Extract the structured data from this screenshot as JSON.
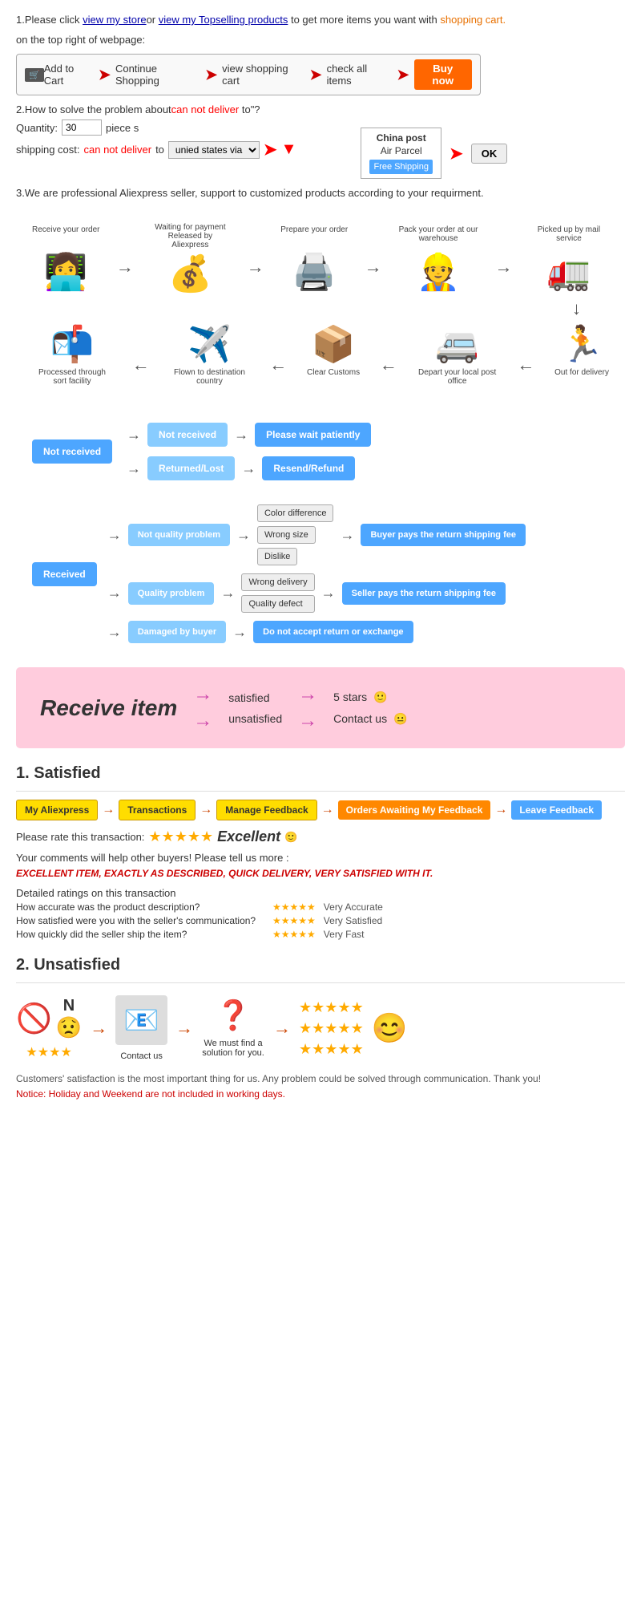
{
  "page": {
    "section1": {
      "text1": "1.Please click ",
      "link1": "view my store",
      "text2": "or ",
      "link2": "view my Topselling products",
      "text3": " to get more items you want with",
      "text4": "shopping cart.",
      "text5": "on the top right of webpage:",
      "flow": {
        "step1": "Add to Cart",
        "step2": "Continue Shopping",
        "step3": "view shopping cart",
        "step4": "check all items",
        "step5": "Buy now"
      }
    },
    "section2": {
      "title": "2.How to solve the problem about",
      "can_not_deliver": "can not deliver",
      "title2": " to\"?",
      "qty_label": "Quantity:",
      "qty_value": "30",
      "qty_unit": "piece s",
      "shipping_label": "shipping cost:",
      "can_not": "can not deliver",
      "to_text": " to ",
      "via_text": "unied states via",
      "china_post_title": "China post",
      "air_parcel": "Air Parcel",
      "free_shipping": "Free Shipping",
      "ok": "OK"
    },
    "section3": {
      "text": "3.We are professional Aliexpress seller, support to customized products according to your requirment."
    },
    "process": {
      "row1": [
        {
          "label_top": "Receive your order",
          "icon": "👩‍💻",
          "label_bot": ""
        },
        {
          "label_top": "Waiting for payment Released by Aliexpress",
          "icon": "💰",
          "label_bot": ""
        },
        {
          "label_top": "Prepare your order",
          "icon": "🖨️",
          "label_bot": ""
        },
        {
          "label_top": "Pack your order at our warehouse",
          "icon": "👷",
          "label_bot": ""
        },
        {
          "label_top": "Picked up by mail service",
          "icon": "🚛",
          "label_bot": ""
        }
      ],
      "row2": [
        {
          "label_top": "",
          "icon": "🏃",
          "label_bot": "Out for delivery"
        },
        {
          "label_top": "",
          "icon": "🚐",
          "label_bot": "Depart your local post office"
        },
        {
          "label_top": "",
          "icon": "📦",
          "label_bot": "Clear Customs"
        },
        {
          "label_top": "",
          "icon": "✈️",
          "label_bot": "Flown to destination country"
        },
        {
          "label_top": "",
          "icon": "📬",
          "label_bot": "Processed through sort facility"
        }
      ]
    },
    "flowchart": {
      "not_received": "Not received",
      "not_received_sub1": "Not received",
      "not_received_sub1_result": "Please wait patiently",
      "not_received_sub2": "Returned/Lost",
      "not_received_sub2_result": "Resend/Refund",
      "received": "Received",
      "not_quality": "Not quality problem",
      "quality": "Quality problem",
      "damaged": "Damaged by buyer",
      "color_diff": "Color difference",
      "wrong_size": "Wrong size",
      "dislike": "Dislike",
      "wrong_delivery": "Wrong delivery",
      "quality_defect": "Quality defect",
      "damaged_result": "Do not accept return or exchange",
      "buyer_pays": "Buyer pays the return shipping fee",
      "seller_pays": "Seller pays the return shipping fee"
    },
    "pink_section": {
      "title": "Receive item",
      "option1": "satisfied",
      "option2": "unsatisfied",
      "result1": "5 stars",
      "result2": "Contact us",
      "emoji1": "🙂",
      "emoji2": "😐"
    },
    "satisfied": {
      "title": "1. Satisfied",
      "flow": [
        "My Aliexpress",
        "Transactions",
        "Manage Feedback",
        "Orders Awaiting My Feedback",
        "Leave Feedback"
      ],
      "rate_text": "Please rate this transaction:",
      "excellent": "Excellent",
      "emoji": "🙂",
      "comment_prompt": "Your comments will help other buyers! Please tell us more :",
      "example": "EXCELLENT ITEM, EXACTLY AS DESCRIBED, QUICK DELIVERY, VERY SATISFIED WITH IT.",
      "ratings_title": "Detailed ratings on this transaction",
      "rating1_label": "How accurate was the product description?",
      "rating1_result": "Very Accurate",
      "rating2_label": "How satisfied were you with the seller's communication?",
      "rating2_result": "Very Satisfied",
      "rating3_label": "How quickly did the seller ship the item?",
      "rating3_result": "Very Fast"
    },
    "unsatisfied": {
      "title": "2. Unsatisfied",
      "steps": [
        "🚫",
        "EMAIL",
        "❓",
        "⭐"
      ],
      "contact_us": "Contact us",
      "find_solution": "We must find a solution for you.",
      "footer": "Customers' satisfaction is the most important thing for us. Any problem could be solved through communication. Thank you!",
      "notice": "Notice: Holiday and Weekend are not included in working days."
    }
  }
}
